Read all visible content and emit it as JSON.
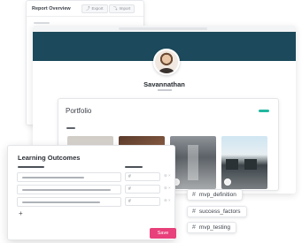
{
  "report": {
    "title": "Report Overview",
    "export_label": "Export",
    "import_label": "Import"
  },
  "profile": {
    "name": "Savannathan"
  },
  "portfolio": {
    "title": "Portfolio"
  },
  "learning_outcomes": {
    "title": "Learning Outcomes",
    "hash_symbol": "#",
    "save_label": "Save",
    "add_symbol": "+"
  },
  "tags": [
    {
      "hash": "#",
      "label": "mvp_definition"
    },
    {
      "hash": "#",
      "label": "success_factors"
    },
    {
      "hash": "#",
      "label": "mvp_testing"
    }
  ],
  "colors": {
    "banner": "#1c4a5c",
    "accent": "#21b8a0",
    "save_button": "#e8407a"
  },
  "icons": {
    "export": "export-icon",
    "import": "import-icon",
    "add": "plus-icon",
    "remove": "close-icon"
  }
}
